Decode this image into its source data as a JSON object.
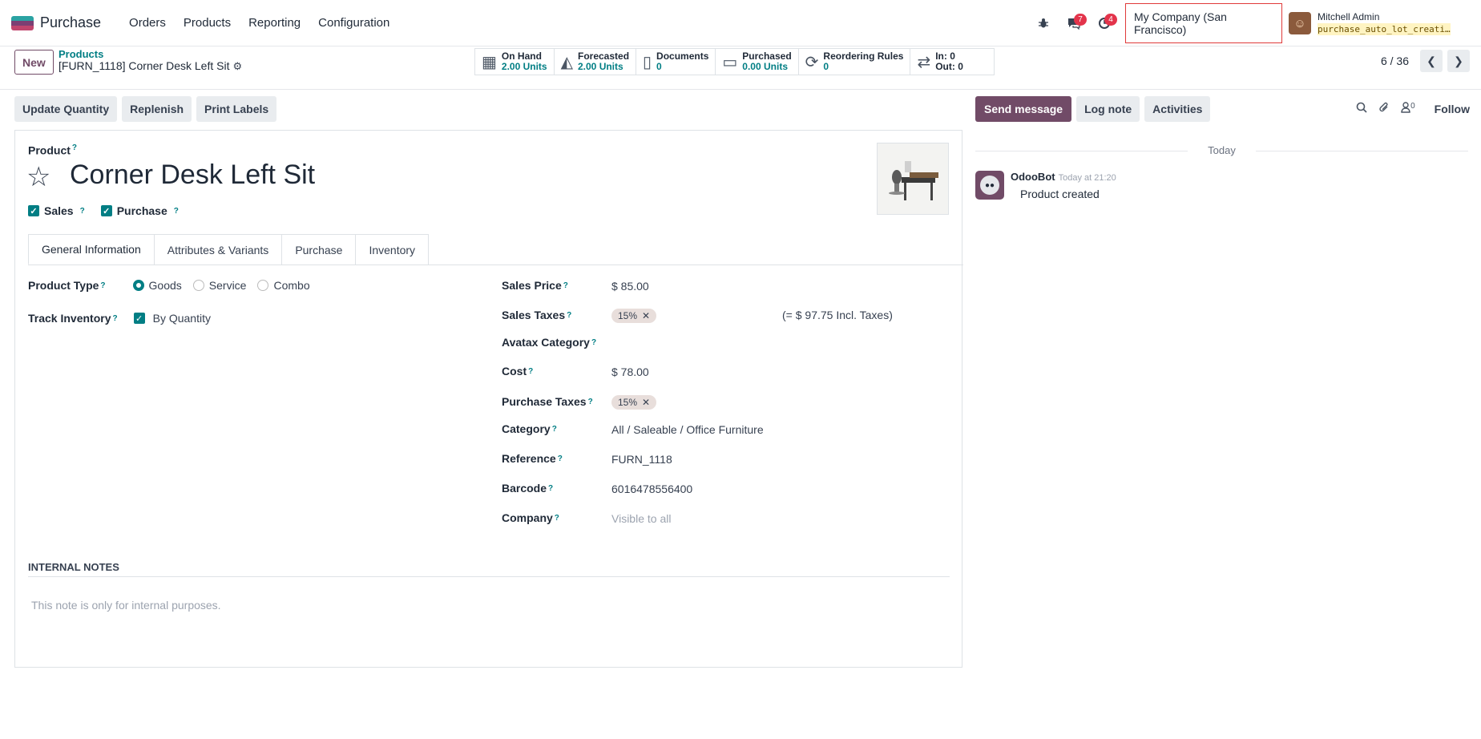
{
  "topbar": {
    "app_name": "Purchase",
    "nav": [
      "Orders",
      "Products",
      "Reporting",
      "Configuration"
    ],
    "bug_icon": "bug-icon",
    "messages_badge": "7",
    "activities_badge": "4",
    "company": "My Company (San Francisco)",
    "user_name": "Mitchell Admin",
    "db_name": "purchase_auto_lot_creati…"
  },
  "subbar": {
    "new_label": "New",
    "breadcrumb_parent": "Products",
    "breadcrumb_current": "[FURN_1118] Corner Desk Left Sit",
    "smart_buttons": [
      {
        "label": "On Hand",
        "value": "2.00 Units",
        "icon": "cubes-icon"
      },
      {
        "label": "Forecasted",
        "value": "2.00 Units",
        "icon": "area-chart-icon"
      },
      {
        "label": "Documents",
        "value": "0",
        "icon": "file-icon"
      },
      {
        "label": "Purchased",
        "value": "0.00 Units",
        "icon": "credit-card-icon"
      },
      {
        "label": "Reordering Rules",
        "value": "0",
        "icon": "refresh-icon"
      },
      {
        "label": "In: 0",
        "value": "Out: 0",
        "icon": "exchange-icon"
      }
    ],
    "pager": "6 / 36"
  },
  "actions": {
    "update_quantity": "Update Quantity",
    "replenish": "Replenish",
    "print_labels": "Print Labels"
  },
  "chatter": {
    "send_message": "Send message",
    "log_note": "Log note",
    "activities": "Activities",
    "followers_count": "0",
    "follow": "Follow",
    "date_separator": "Today",
    "message_author": "OdooBot",
    "message_time": "Today at 21:20",
    "message_text": "Product created"
  },
  "form": {
    "product_label": "Product",
    "product_name": "Corner Desk Left Sit",
    "sales_label": "Sales",
    "purchase_label": "Purchase",
    "tabs": [
      "General Information",
      "Attributes & Variants",
      "Purchase",
      "Inventory"
    ],
    "product_type_label": "Product Type",
    "product_type_options": [
      "Goods",
      "Service",
      "Combo"
    ],
    "track_inventory_label": "Track Inventory",
    "track_inventory_value": "By Quantity",
    "sales_price_label": "Sales Price",
    "sales_price": "$ 85.00",
    "sales_taxes_label": "Sales Taxes",
    "sales_tax_tag": "15%",
    "incl_taxes": "(= $ 97.75 Incl. Taxes)",
    "avatax_label": "Avatax Category",
    "cost_label": "Cost",
    "cost": "$ 78.00",
    "purchase_taxes_label": "Purchase Taxes",
    "purchase_tax_tag": "15%",
    "category_label": "Category",
    "category": "All / Saleable / Office Furniture",
    "reference_label": "Reference",
    "reference": "FURN_1118",
    "barcode_label": "Barcode",
    "barcode": "6016478556400",
    "company_label": "Company",
    "company_placeholder": "Visible to all",
    "internal_notes_title": "INTERNAL NOTES",
    "internal_notes_placeholder": "This note is only for internal purposes."
  },
  "colors": {
    "accent": "#714b67",
    "teal": "#017e84",
    "highlight_border": "#e03a3a"
  }
}
